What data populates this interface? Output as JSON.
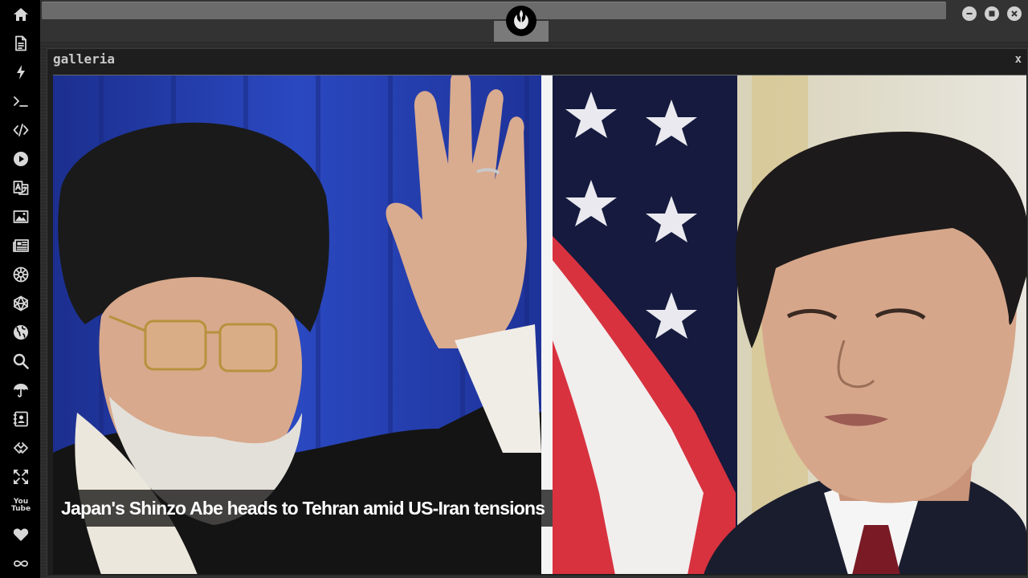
{
  "sidebar": {
    "items": [
      {
        "name": "home-icon"
      },
      {
        "name": "document-icon"
      },
      {
        "name": "lightning-icon"
      },
      {
        "name": "terminal-icon"
      },
      {
        "name": "code-icon"
      },
      {
        "name": "play-icon"
      },
      {
        "name": "translate-icon"
      },
      {
        "name": "image-icon"
      },
      {
        "name": "newspaper-icon"
      },
      {
        "name": "empire-icon"
      },
      {
        "name": "hexagon-icon"
      },
      {
        "name": "globe-icon"
      },
      {
        "name": "search-icon"
      },
      {
        "name": "umbrella-icon"
      },
      {
        "name": "contact-icon"
      },
      {
        "name": "link-icon"
      },
      {
        "name": "expand-icon"
      },
      {
        "name": "youtube-icon",
        "label": "You Tube"
      },
      {
        "name": "heart-icon"
      },
      {
        "name": "infinity-icon"
      }
    ]
  },
  "window_controls": [
    "minimize-icon",
    "maximize-icon",
    "close-icon"
  ],
  "galleria": {
    "title": "galleria",
    "close_label": "x",
    "caption": "Japan's Shinzo Abe heads to Tehran amid US-Iran tensions"
  },
  "colors": {
    "background": "#2b2b2b",
    "sidebar": "#000000",
    "caption_text": "#ffffff",
    "photo_left_bg": "#1f3aa8",
    "flag_red": "#d8323f"
  }
}
